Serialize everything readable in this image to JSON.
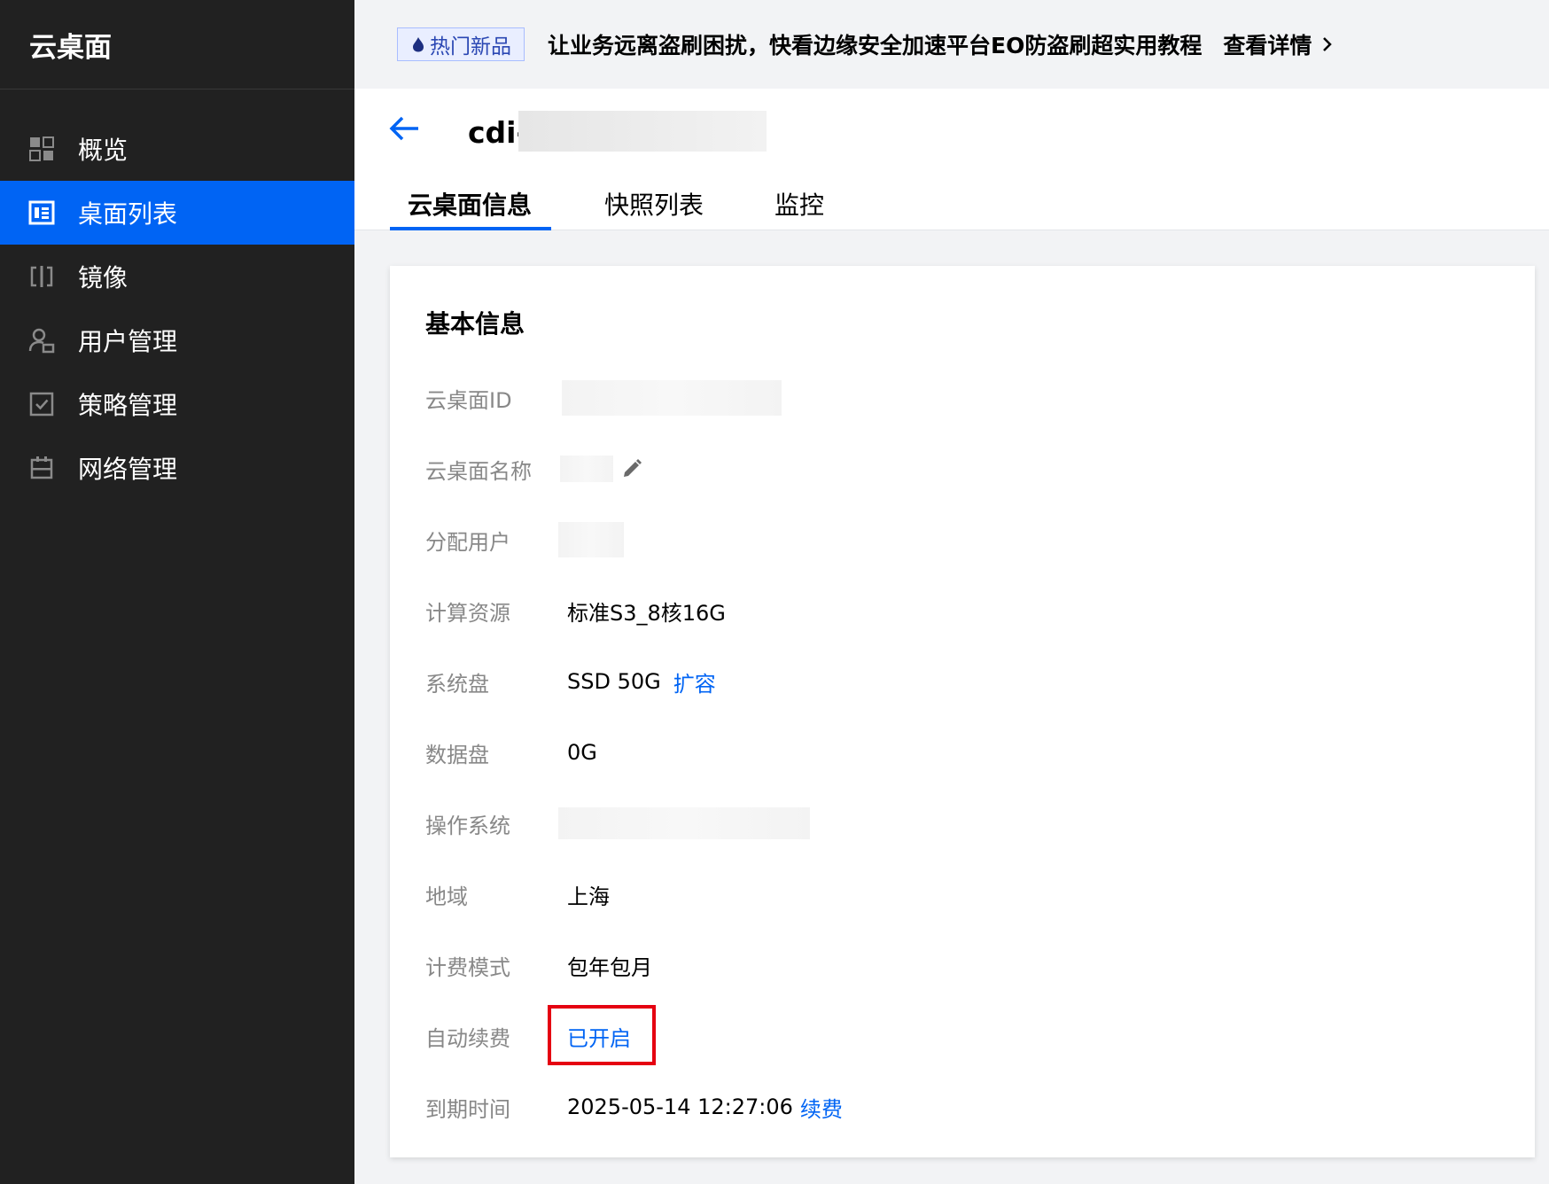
{
  "sidebar": {
    "brand": "云桌面",
    "items": [
      {
        "label": "概览",
        "icon": "dashboard-grid-icon"
      },
      {
        "label": "桌面列表",
        "icon": "desktop-list-icon"
      },
      {
        "label": "镜像",
        "icon": "image-mirror-icon"
      },
      {
        "label": "用户管理",
        "icon": "user-manage-icon"
      },
      {
        "label": "策略管理",
        "icon": "policy-check-icon"
      },
      {
        "label": "网络管理",
        "icon": "network-icon"
      }
    ],
    "active_index": 1
  },
  "banner": {
    "badge": "热门新品",
    "text": "让业务远离盗刷困扰，快看边缘安全加速平台EO防盗刷超实用教程",
    "link": "查看详情"
  },
  "header": {
    "title": "cdi-",
    "tabs": [
      "云桌面信息",
      "快照列表",
      "监控"
    ],
    "active_tab": 0
  },
  "card": {
    "title": "基本信息",
    "rows": {
      "desktop_id": {
        "label": "云桌面ID",
        "value": ""
      },
      "desktop_name": {
        "label": "云桌面名称",
        "value": ""
      },
      "assigned_user": {
        "label": "分配用户",
        "value": ""
      },
      "compute": {
        "label": "计算资源",
        "value": "标准S3_8核16G"
      },
      "system_disk": {
        "label": "系统盘",
        "value": "SSD 50G",
        "action": "扩容"
      },
      "data_disk": {
        "label": "数据盘",
        "value": "0G"
      },
      "os": {
        "label": "操作系统",
        "value": ""
      },
      "region": {
        "label": "地域",
        "value": "上海"
      },
      "billing": {
        "label": "计费模式",
        "value": "包年包月"
      },
      "auto_renew": {
        "label": "自动续费",
        "value": "已开启"
      },
      "expire": {
        "label": "到期时间",
        "value": "2025-05-14 12:27:06",
        "action": "续费"
      }
    }
  },
  "colors": {
    "accent": "#0064f4",
    "sidebar_bg": "#212121",
    "highlight_border": "#e50011"
  }
}
